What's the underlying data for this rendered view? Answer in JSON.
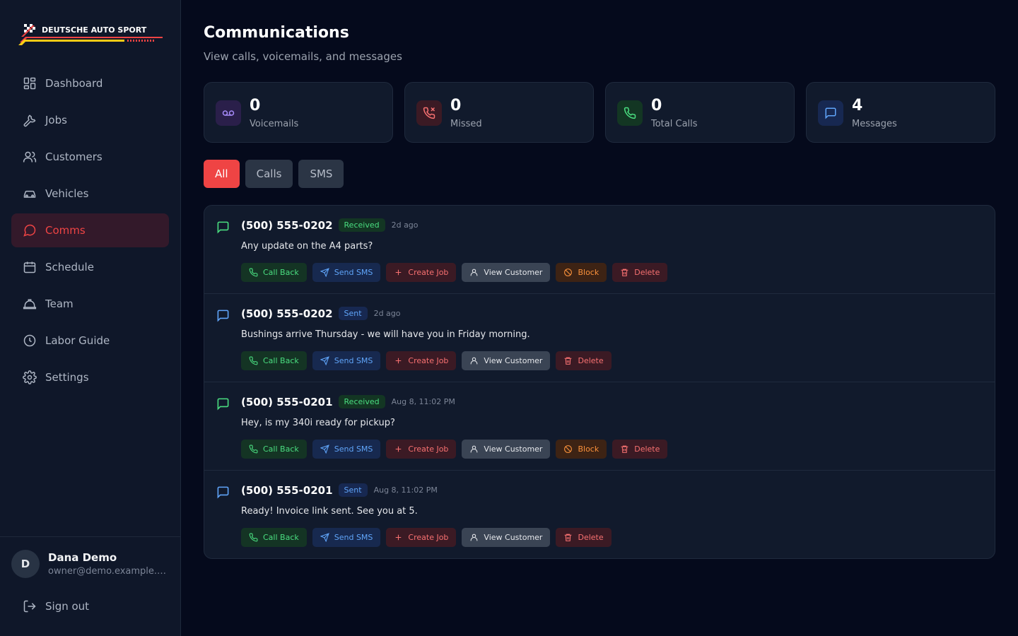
{
  "brand": {
    "name": "DEUTSCHE AUTO SPORT"
  },
  "sidebar": {
    "items": [
      {
        "label": "Dashboard",
        "icon": "dashboard-icon"
      },
      {
        "label": "Jobs",
        "icon": "wrench-icon"
      },
      {
        "label": "Customers",
        "icon": "users-icon"
      },
      {
        "label": "Vehicles",
        "icon": "car-icon"
      },
      {
        "label": "Comms",
        "icon": "message-circle-icon",
        "active": true
      },
      {
        "label": "Schedule",
        "icon": "calendar-icon"
      },
      {
        "label": "Team",
        "icon": "team-icon"
      },
      {
        "label": "Labor Guide",
        "icon": "clock-icon"
      },
      {
        "label": "Settings",
        "icon": "gear-icon"
      }
    ],
    "user": {
      "initial": "D",
      "name": "Dana Demo",
      "email": "owner@demo.example.co..."
    },
    "signout_label": "Sign out"
  },
  "header": {
    "title": "Communications",
    "subtitle": "View calls, voicemails, and messages"
  },
  "stats": [
    {
      "value": "0",
      "label": "Voicemails",
      "icon": "voicemail-icon",
      "color": "#a78bfa"
    },
    {
      "value": "0",
      "label": "Missed",
      "icon": "phone-missed-icon",
      "color": "#f87171"
    },
    {
      "value": "0",
      "label": "Total Calls",
      "icon": "phone-icon",
      "color": "#4ade80"
    },
    {
      "value": "4",
      "label": "Messages",
      "icon": "message-square-icon",
      "color": "#60a5fa"
    }
  ],
  "tabs": [
    {
      "label": "All",
      "active": true
    },
    {
      "label": "Calls"
    },
    {
      "label": "SMS"
    }
  ],
  "actions": {
    "call_back": "Call Back",
    "send_sms": "Send SMS",
    "create_job": "Create Job",
    "view_customer": "View Customer",
    "block": "Block",
    "delete": "Delete"
  },
  "messages": [
    {
      "phone": "(500) 555-0202",
      "status": "Received",
      "time": "2d ago",
      "text": "Any update on the A4 parts?",
      "icon_color": "#4ade80"
    },
    {
      "phone": "(500) 555-0202",
      "status": "Sent",
      "time": "2d ago",
      "text": "Bushings arrive Thursday - we will have you in Friday morning.",
      "icon_color": "#60a5fa"
    },
    {
      "phone": "(500) 555-0201",
      "status": "Received",
      "time": "Aug 8, 11:02 PM",
      "text": "Hey, is my 340i ready for pickup?",
      "icon_color": "#4ade80"
    },
    {
      "phone": "(500) 555-0201",
      "status": "Sent",
      "time": "Aug 8, 11:02 PM",
      "text": "Ready! Invoice link sent. See you at 5.",
      "icon_color": "#60a5fa"
    }
  ],
  "colors": {
    "accent": "#ef4444",
    "background": "#050a1c",
    "panel": "#111a2c"
  }
}
